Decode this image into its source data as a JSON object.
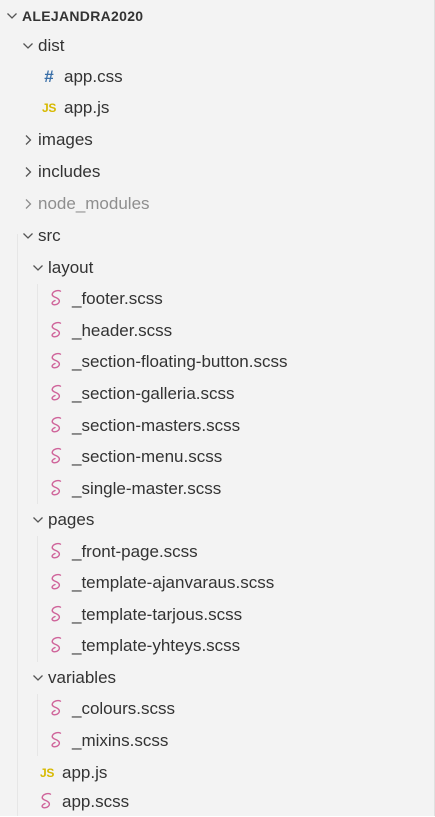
{
  "explorer": {
    "root_label": "ALEJANDRA2020",
    "colors": {
      "text": "#333333",
      "dim_text": "#8e8e8e",
      "css_icon": "#3a6fa8",
      "js_icon": "#d7b900",
      "sass_icon": "#cf649a"
    },
    "tree": [
      {
        "label": "dist",
        "kind": "folder-open"
      },
      {
        "label": "app.css",
        "kind": "file",
        "icon": "css-hash-icon",
        "icon_text": "#"
      },
      {
        "label": "app.js",
        "kind": "file",
        "icon": "js-icon",
        "icon_text": "JS"
      },
      {
        "label": "images",
        "kind": "folder-closed"
      },
      {
        "label": "includes",
        "kind": "folder-closed"
      },
      {
        "label": "node_modules",
        "kind": "folder-closed",
        "dimmed": true
      },
      {
        "label": "src",
        "kind": "folder-open"
      },
      {
        "label": "layout",
        "kind": "folder-open"
      },
      {
        "label": "_footer.scss",
        "kind": "file",
        "icon": "sass-icon"
      },
      {
        "label": "_header.scss",
        "kind": "file",
        "icon": "sass-icon"
      },
      {
        "label": "_section-floating-button.scss",
        "kind": "file",
        "icon": "sass-icon"
      },
      {
        "label": "_section-galleria.scss",
        "kind": "file",
        "icon": "sass-icon"
      },
      {
        "label": "_section-masters.scss",
        "kind": "file",
        "icon": "sass-icon"
      },
      {
        "label": "_section-menu.scss",
        "kind": "file",
        "icon": "sass-icon"
      },
      {
        "label": "_single-master.scss",
        "kind": "file",
        "icon": "sass-icon"
      },
      {
        "label": "pages",
        "kind": "folder-open"
      },
      {
        "label": "_front-page.scss",
        "kind": "file",
        "icon": "sass-icon"
      },
      {
        "label": "_template-ajanvaraus.scss",
        "kind": "file",
        "icon": "sass-icon"
      },
      {
        "label": "_template-tarjous.scss",
        "kind": "file",
        "icon": "sass-icon"
      },
      {
        "label": "_template-yhteys.scss",
        "kind": "file",
        "icon": "sass-icon"
      },
      {
        "label": "variables",
        "kind": "folder-open"
      },
      {
        "label": "_colours.scss",
        "kind": "file",
        "icon": "sass-icon"
      },
      {
        "label": "_mixins.scss",
        "kind": "file",
        "icon": "sass-icon"
      },
      {
        "label": "app.js",
        "kind": "file",
        "icon": "js-icon",
        "icon_text": "JS"
      },
      {
        "label": "app.scss",
        "kind": "file",
        "icon": "sass-icon"
      }
    ]
  }
}
